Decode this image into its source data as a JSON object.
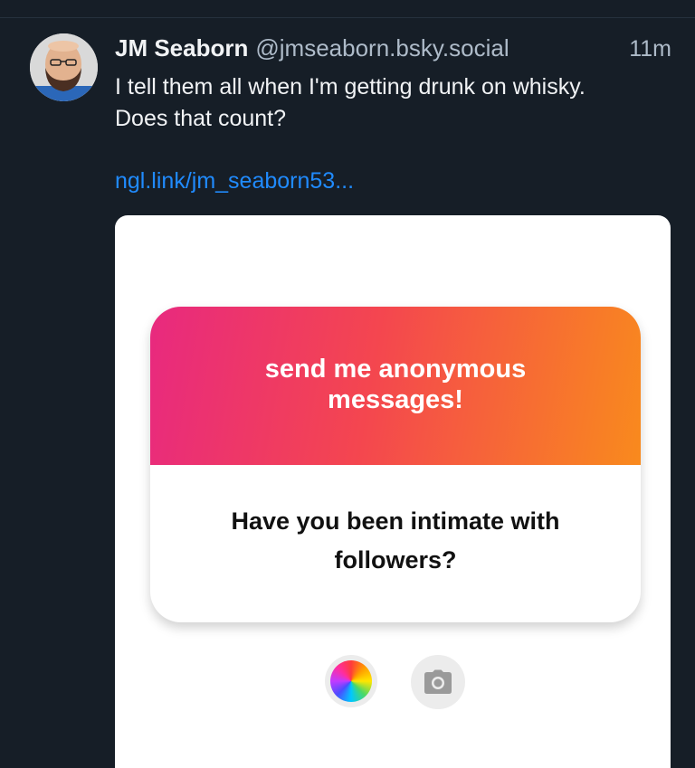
{
  "post": {
    "author_name": "JM Seaborn",
    "author_handle": "@jmseaborn.bsky.social",
    "time": "11m",
    "text": "I tell them all when I'm getting drunk on whisky.\nDoes that count?",
    "link": "ngl.link/jm_seaborn53..."
  },
  "embed": {
    "ngl_title": "send me anonymous messages!",
    "question": "Have you been intimate with followers?",
    "buttons": {
      "color_icon": "color-wheel-icon",
      "camera_icon": "camera-icon"
    }
  },
  "colors": {
    "background": "#161e27",
    "link": "#208bfe",
    "gradient_start": "#e8297f",
    "gradient_end": "#f98a1d"
  }
}
